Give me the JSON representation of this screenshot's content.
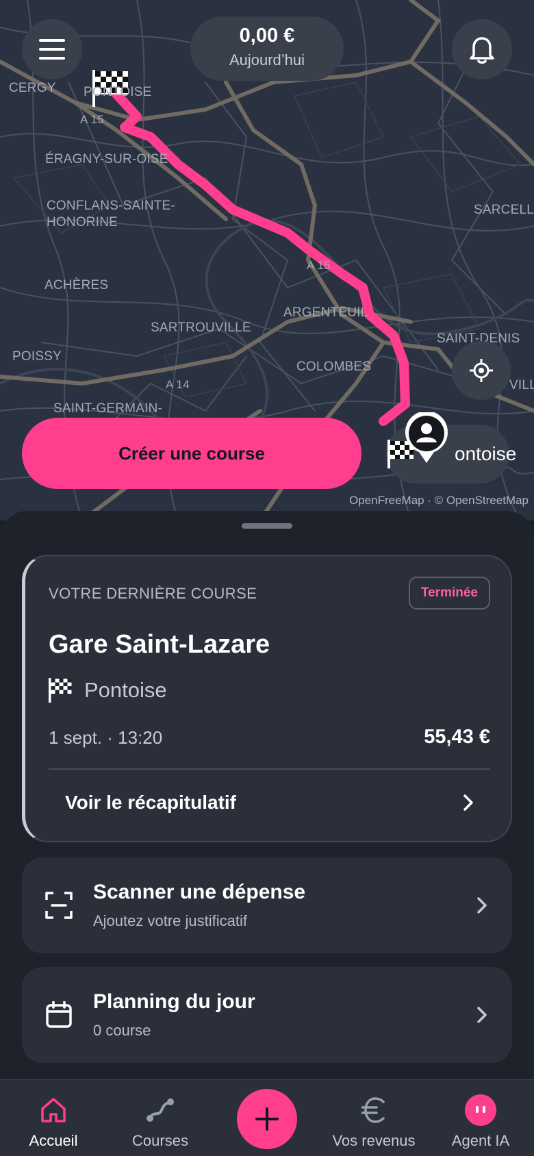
{
  "header": {
    "earnings_amount": "0,00 €",
    "earnings_label": "Aujourd’hui"
  },
  "map": {
    "places": [
      "CERGY",
      "PONTOISE",
      "A 15",
      "ÉRAGNY-SUR-OISE",
      "CONFLANS-SAINTE-",
      "HONORINE",
      "SARCELLE",
      "A 15",
      "ACHÈRES",
      "ARGENTEUIL",
      "SARTROUVILLE",
      "SAINT-DENIS",
      "POISSY",
      "COLOMBES",
      "A 14",
      "VILL",
      "SAINT-GERMAIN-"
    ],
    "attribution": "OpenFreeMap · © OpenStreetMap",
    "route_color": "#ff3e8d"
  },
  "actions": {
    "create_ride": "Créer une course",
    "destination": "ontoise"
  },
  "last_ride": {
    "heading": "VOTRE DERNIÈRE COURSE",
    "status": "Terminée",
    "origin": "Gare Saint-Lazare",
    "destination": "Pontoise",
    "datetime": "1 sept. · 13:20",
    "price": "55,43 €",
    "summary_link": "Voir le récapitulatif"
  },
  "cards": {
    "scan": {
      "title": "Scanner une dépense",
      "subtitle": "Ajoutez votre justificatif"
    },
    "planning": {
      "title": "Planning du jour",
      "subtitle": "0 course"
    }
  },
  "nav": {
    "home": "Accueil",
    "courses": "Courses",
    "revenus": "Vos revenus",
    "agent": "Agent IA"
  },
  "colors": {
    "accent": "#ff3e8d",
    "background": "#1b1f27",
    "card": "#2a2f3a"
  },
  "icons": [
    "menu-icon",
    "bell-icon",
    "locate-icon",
    "flag-icon",
    "avatar-pin-icon",
    "chevron-right-icon",
    "scan-icon",
    "calendar-icon",
    "home-icon",
    "route-icon",
    "plus-icon",
    "euro-icon",
    "agent-icon"
  ]
}
